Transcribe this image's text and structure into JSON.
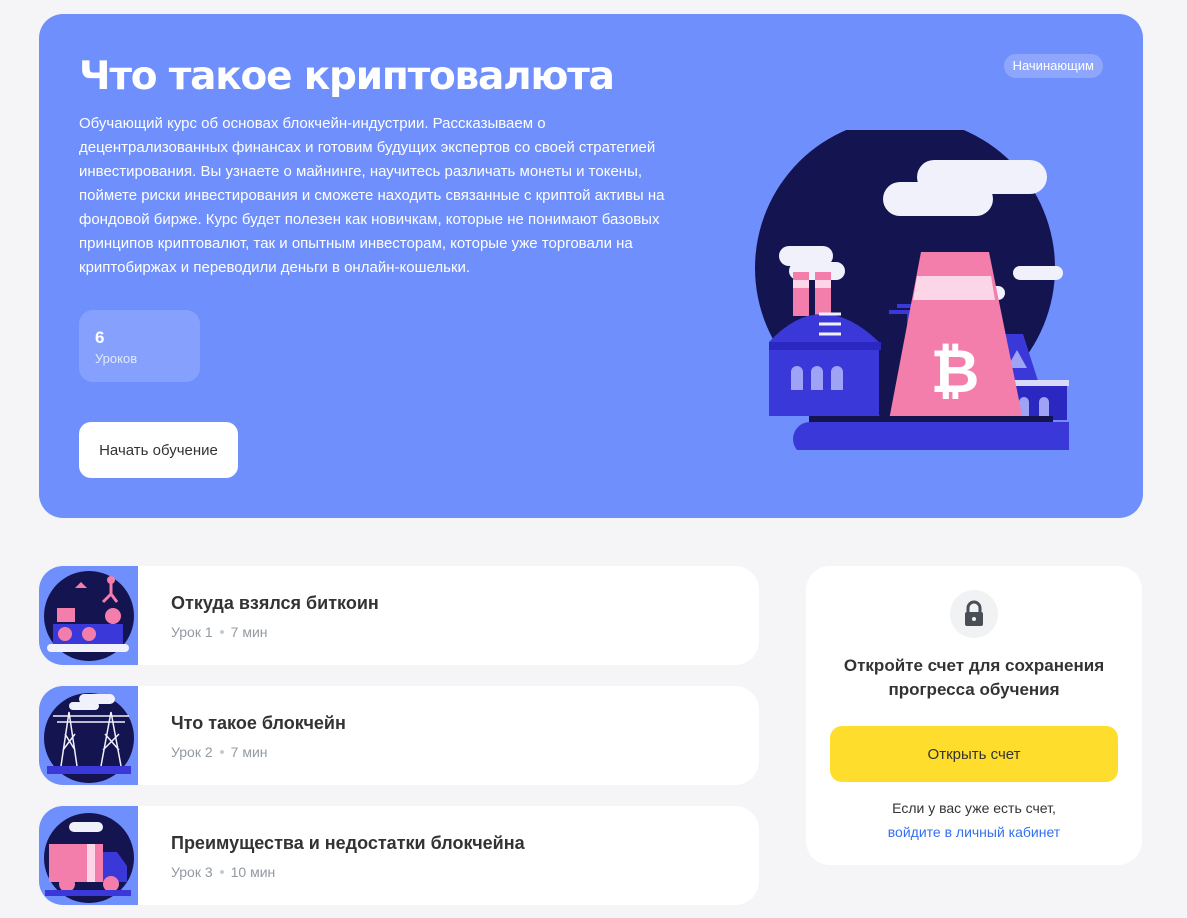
{
  "hero": {
    "title": "Что такое криптовалюта",
    "level_badge": "Начинающим",
    "description": "Обучающий курс об основах блокчейн-индустрии. Рассказываем о децентрализованных финансах и готовим будущих экспертов со своей стратегией инвестирования. Вы узнаете о майнинге, научитесь различать монеты и токены, поймете риски инвестирования и сможете находить связанные с криптой активы на фондовой бирже. Курс будет полезен как новичкам, которые не понимают базовых принципов криптовалют, так и опытным инвесторам, которые уже торговали на криптобиржах и переводили деньги в онлайн-кошельки.",
    "stat_count": "6",
    "stat_label": "Уроков",
    "start_button": "Начать обучение",
    "art_icon": "crypto-factory-illustration"
  },
  "lessons": [
    {
      "title": "Откуда взялся биткоин",
      "lesson": "Урок 1",
      "duration": "7 мин",
      "icon": "bitcoin-conveyor-illustration"
    },
    {
      "title": "Что такое блокчейн",
      "lesson": "Урок 2",
      "duration": "7 мин",
      "icon": "power-towers-illustration"
    },
    {
      "title": "Преимущества и недостатки блокчейна",
      "lesson": "Урок 3",
      "duration": "10 мин",
      "icon": "bitcoin-truck-illustration"
    }
  ],
  "sidebar": {
    "title": "Откройте счет для сохранения прогресса обучения",
    "open_button": "Открыть счет",
    "note": "Если у вас уже есть счет,",
    "login_link": "войдите в личный кабинет",
    "lock_icon": "lock-icon"
  },
  "colors": {
    "hero_bg": "#6f8ffd",
    "accent_yellow": "#ffdd2d",
    "link_blue": "#336fee",
    "illustration_navy": "#141451",
    "illustration_pink": "#f47eab",
    "illustration_indigo": "#3a38d8"
  }
}
